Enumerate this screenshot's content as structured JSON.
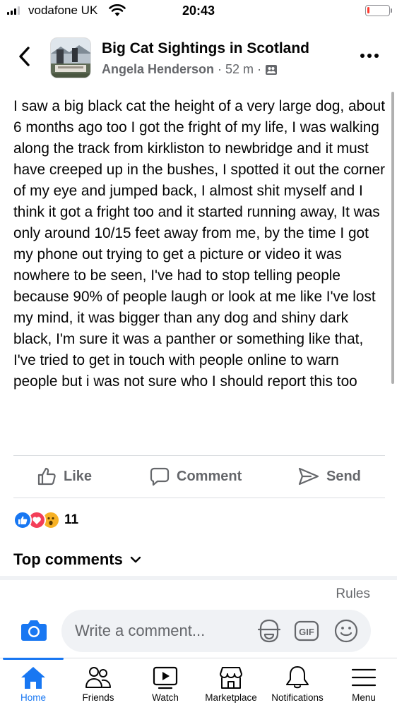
{
  "status_bar": {
    "carrier": "vodafone UK",
    "time": "20:43",
    "battery_level": 0.1,
    "battery_color": "#ff3b30"
  },
  "post": {
    "group_name": "Big Cat Sightings in Scotland",
    "author": "Angela Henderson",
    "time_ago": "52 m",
    "separator": "·",
    "privacy_icon": "group-members-icon",
    "body": "I saw a big black cat the height of a very large dog, about 6 months ago too I got the fright of my life, I was walking along the track from kirkliston to newbridge and it must have creeped up in the bushes, I spotted it out the corner of my eye and jumped back, I almost shit myself and I think it got a fright too and it started running away, It was only around 10/15 feet away from me, by the time I got my phone out trying to get a picture  or video it was nowhere to be seen, I've had to stop telling people because 90% of people laugh or look at me like I've lost my mind, it was bigger than any dog and shiny dark black, I'm sure it was a panther or something like that, I've tried to get in touch with people online to warn people but i was not sure who I should report this too"
  },
  "actions": {
    "like": "Like",
    "comment": "Comment",
    "send": "Send"
  },
  "reactions": {
    "types": [
      "like",
      "love",
      "wow"
    ],
    "count": "11"
  },
  "comments": {
    "sort_label": "Top comments",
    "rules": "Rules",
    "placeholder": "Write a comment..."
  },
  "tabs": [
    {
      "label": "Home",
      "icon": "home-icon",
      "active": true
    },
    {
      "label": "Friends",
      "icon": "friends-icon"
    },
    {
      "label": "Watch",
      "icon": "watch-icon"
    },
    {
      "label": "Marketplace",
      "icon": "marketplace-icon"
    },
    {
      "label": "Notifications",
      "icon": "bell-icon"
    },
    {
      "label": "Menu",
      "icon": "menu-icon"
    }
  ],
  "colors": {
    "accent": "#1877f2",
    "secondary_text": "#65676b",
    "love": "#f33e58",
    "wow": "#f7b125"
  }
}
